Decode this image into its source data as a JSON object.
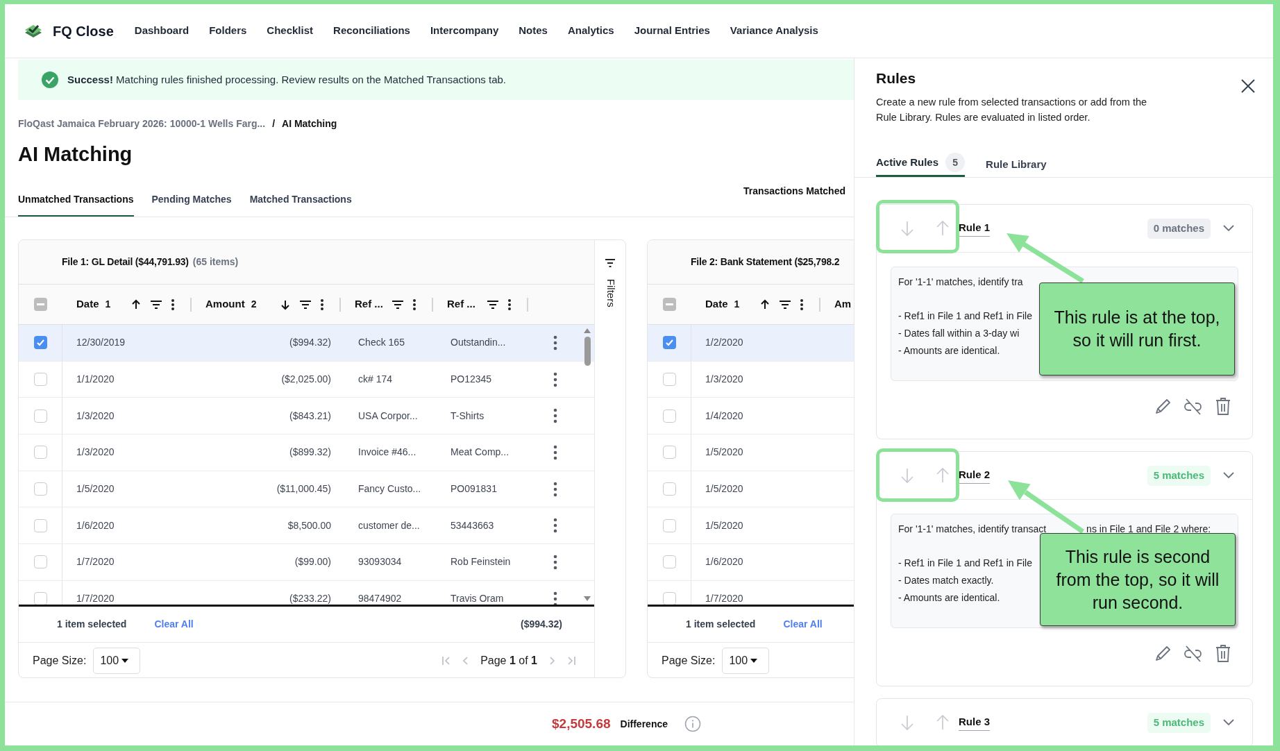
{
  "app": {
    "name": "FQ Close"
  },
  "nav": [
    "Dashboard",
    "Folders",
    "Checklist",
    "Reconciliations",
    "Intercompany",
    "Notes",
    "Analytics",
    "Journal Entries",
    "Variance Analysis"
  ],
  "banner": {
    "kind": "success",
    "title": "Success!",
    "message": "Matching rules finished processing. Review results on the Matched Transactions tab."
  },
  "breadcrumb": {
    "parent": "FloQast Jamaica February 2026: 10000-1 Wells Farg...",
    "separator": "/",
    "current": "AI Matching"
  },
  "page_title": "AI Matching",
  "tabs": [
    {
      "label": "Unmatched Transactions",
      "selected": true
    },
    {
      "label": "Pending Matches",
      "selected": false
    },
    {
      "label": "Matched Transactions",
      "selected": false
    }
  ],
  "summary_label": "Transactions Matched",
  "files": [
    {
      "title": "File 1: GL Detail",
      "total": "($44,791.93)",
      "count": "(65 items)",
      "indeterminate": true,
      "row_actions": true,
      "filters_label": "Filters",
      "columns": [
        {
          "label": "Date",
          "priority": "1",
          "sorted": true,
          "descending": false,
          "filter": true,
          "menu": true
        },
        {
          "label": "Amount",
          "priority": "2",
          "sorted": true,
          "descending": true,
          "filter": true,
          "menu": true
        },
        {
          "label": "Ref ...",
          "sorted": false,
          "filter": true,
          "menu": true
        },
        {
          "label": "Ref ...",
          "sorted": false,
          "filter": true,
          "menu": true
        }
      ],
      "rows": [
        {
          "selected": true,
          "cells": [
            "12/30/2019",
            "($994.32)",
            "Check 165",
            "Outstandin..."
          ]
        },
        {
          "selected": false,
          "cells": [
            "1/1/2020",
            "($2,025.00)",
            "ck# 174",
            "PO12345"
          ]
        },
        {
          "selected": false,
          "cells": [
            "1/3/2020",
            "($843.21)",
            "USA Corpor...",
            "T-Shirts"
          ]
        },
        {
          "selected": false,
          "cells": [
            "1/3/2020",
            "($899.32)",
            "Invoice #46...",
            "Meat Comp..."
          ]
        },
        {
          "selected": false,
          "cells": [
            "1/5/2020",
            "($11,000.45)",
            "Fancy Custo...",
            "PO091831"
          ]
        },
        {
          "selected": false,
          "cells": [
            "1/6/2020",
            "$8,500.00",
            "customer de...",
            "53443663"
          ]
        },
        {
          "selected": false,
          "cells": [
            "1/7/2020",
            "($99.00)",
            "93093034",
            "Rob Feinstein"
          ]
        },
        {
          "selected": false,
          "cells": [
            "1/7/2020",
            "($233.22)",
            "98474902",
            "Travis Oram"
          ]
        }
      ],
      "footer": {
        "selection": "1 item selected",
        "clear": "Clear All",
        "selected_total": "($994.32)"
      },
      "pager": {
        "page_size_label": "Page Size:",
        "page_size": "100",
        "page_label": "Page",
        "page": "1",
        "of": "of",
        "pages": "1"
      }
    },
    {
      "title": "File 2: Bank Statement",
      "total": "($25,798.2",
      "indeterminate": true,
      "columns": [
        {
          "label": "Date",
          "priority": "1",
          "sorted": true,
          "descending": false,
          "filter": true,
          "menu": true
        },
        {
          "label": "Am"
        }
      ],
      "rows": [
        {
          "selected": true,
          "cells": [
            "1/2/2020"
          ]
        },
        {
          "selected": false,
          "cells": [
            "1/3/2020"
          ]
        },
        {
          "selected": false,
          "cells": [
            "1/4/2020"
          ]
        },
        {
          "selected": false,
          "cells": [
            "1/5/2020"
          ]
        },
        {
          "selected": false,
          "cells": [
            "1/5/2020"
          ]
        },
        {
          "selected": false,
          "cells": [
            "1/5/2020"
          ]
        },
        {
          "selected": false,
          "cells": [
            "1/6/2020"
          ]
        },
        {
          "selected": false,
          "cells": [
            "1/7/2020"
          ]
        }
      ],
      "footer": {
        "selection": "1 item selected",
        "clear": "Clear All"
      },
      "pager": {
        "page_size_label": "Page Size:",
        "page_size": "100"
      }
    }
  ],
  "difference": {
    "amount": "$2,505.68",
    "label": "Difference"
  },
  "rules_panel": {
    "title": "Rules",
    "description": "Create a new rule from selected transactions or add from the Rule Library. Rules are evaluated in listed order.",
    "tabs": [
      {
        "label": "Active Rules",
        "count": "5",
        "selected": true
      },
      {
        "label": "Rule Library",
        "selected": false
      }
    ],
    "rules": [
      {
        "name": "Rule 1",
        "matches": "0 matches",
        "highlighted": false,
        "intro": [
          "For '1-1' matches, identify tra"
        ],
        "conditions": [
          "- Ref1 in File 1 and Ref1 in File",
          "- Dates fall within a 3-day wi",
          "- Amounts are identical."
        ]
      },
      {
        "name": "Rule 2",
        "matches": "5 matches",
        "highlighted": true,
        "intro": [
          "For '1-1' matches, identify transact",
          "ns in File 1 and File 2 where:"
        ],
        "conditions": [
          "- Ref1 in File 1 and Ref1 in File",
          "- Dates match exactly.",
          "- Amounts are identical."
        ]
      },
      {
        "name": "Rule 3",
        "matches": "5 matches",
        "highlighted": true
      }
    ]
  },
  "callouts": [
    {
      "text": "This rule is at the top, so it will run first."
    },
    {
      "text": "This rule is second from the top, so it will run second."
    }
  ]
}
